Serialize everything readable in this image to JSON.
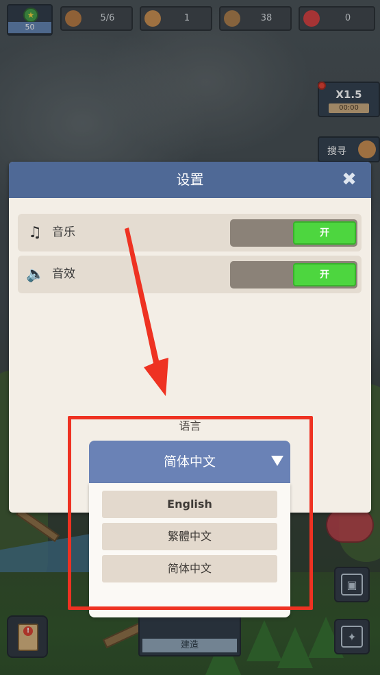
{
  "hud": {
    "level": "50",
    "items": [
      {
        "name": "population",
        "value": "5/6",
        "color": "#b5763c"
      },
      {
        "name": "food",
        "value": "1",
        "color": "#c98b4a"
      },
      {
        "name": "wood",
        "value": "38",
        "color": "#a87845"
      },
      {
        "name": "berry",
        "value": "0",
        "color": "#d33a3a"
      }
    ],
    "speed": {
      "multiplier": "X1.5",
      "timer": "00:00"
    },
    "search_label": "搜寻",
    "build_label": "建造"
  },
  "settings": {
    "title": "设置",
    "close_glyph": "✖",
    "rows": [
      {
        "label": "音乐",
        "icon": "music-note-icon",
        "glyph": "♫",
        "toggle": "开"
      },
      {
        "label": "音效",
        "icon": "speaker-icon",
        "glyph": "🔈",
        "toggle": "开"
      }
    ],
    "language_label": "语言",
    "language_selected": "简体中文",
    "language_options": [
      "English",
      "繁體中文",
      "简体中文"
    ]
  },
  "colors": {
    "header": "#4f6996",
    "toggle_on": "#4dd63f",
    "annotation": "#ee3222"
  }
}
